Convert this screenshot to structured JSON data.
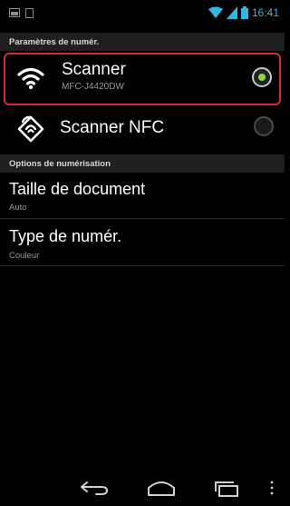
{
  "status_bar": {
    "time": "16:41",
    "accent": "#35b5e5"
  },
  "sections": {
    "scan_settings": "Paramètres de numér.",
    "scan_options": "Options de numérisation"
  },
  "scanner": {
    "title": "Scanner",
    "model": "MFC-J4420DW",
    "selected": true
  },
  "nfc": {
    "title": "Scanner NFC",
    "selected": false
  },
  "options": {
    "doc_size": {
      "title": "Taille de document",
      "value": "Auto"
    },
    "scan_type": {
      "title": "Type de numér.",
      "value": "Couleur"
    }
  },
  "colors": {
    "highlight": "#d42b2b",
    "radio_on": "#8cd63a"
  },
  "icons": {
    "wifi": "wifi-icon",
    "nfc": "nfc-icon",
    "back": "back-icon",
    "home": "home-icon",
    "recents": "recents-icon",
    "menu": "overflow-menu-icon"
  }
}
